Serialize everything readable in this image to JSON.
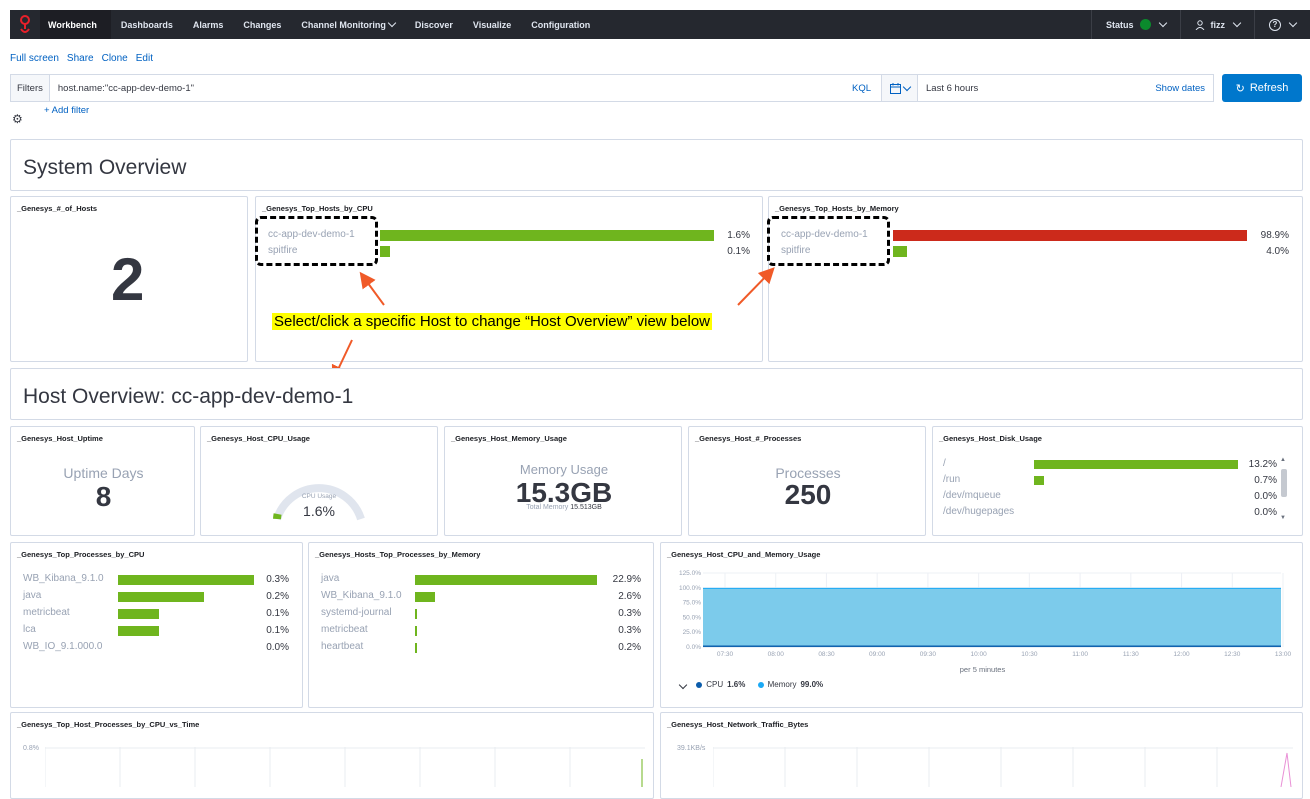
{
  "nav": {
    "brand": "Workbench",
    "items": [
      "Dashboards",
      "Alarms",
      "Changes",
      "Channel Monitoring",
      "Discover",
      "Visualize",
      "Configuration"
    ],
    "status_label": "Status",
    "user": "fizz",
    "help": "?"
  },
  "actions": {
    "full_screen": "Full screen",
    "share": "Share",
    "clone": "Clone",
    "edit": "Edit"
  },
  "filters": {
    "label": "Filters",
    "query": "host.name:\"cc-app-dev-demo-1\"",
    "kql": "KQL",
    "time_range": "Last 6 hours",
    "show_dates": "Show dates",
    "refresh": "Refresh",
    "add_filter": "+ Add filter"
  },
  "system_overview": {
    "title": "System Overview",
    "num_hosts_title": "_Genesys_#_of_Hosts",
    "num_hosts_value": "2",
    "cpu_title": "_Genesys_Top_Hosts_by_CPU",
    "cpu_hosts": [
      {
        "name": "cc-app-dev-demo-1",
        "value": "1.6%",
        "fraction": 1.0
      },
      {
        "name": "spitfire",
        "value": "0.1%",
        "fraction": 0.035
      }
    ],
    "mem_title": "_Genesys_Top_Hosts_by_Memory",
    "mem_hosts": [
      {
        "name": "cc-app-dev-demo-1",
        "value": "98.9%",
        "fraction": 1.0
      },
      {
        "name": "spitfire",
        "value": "4.0%",
        "fraction": 0.04
      }
    ]
  },
  "annotation": "Select/click a specific Host to change “Host Overview” view below",
  "host_overview": {
    "title": "Host Overview: cc-app-dev-demo-1",
    "uptime_title": "_Genesys_Host_Uptime",
    "uptime_label": "Uptime Days",
    "uptime_value": "8",
    "cpu_title": "_Genesys_Host_CPU_Usage",
    "cpu_gauge_label": "CPU Usage",
    "cpu_gauge_value": "1.6%",
    "cpu_gauge_fraction": 0.016,
    "mem_title": "_Genesys_Host_Memory_Usage",
    "mem_label": "Memory Usage",
    "mem_value": "15.3GB",
    "mem_total_label": "Total Memory",
    "mem_total_value": "15.513GB",
    "proc_title": "_Genesys_Host_#_Processes",
    "proc_label": "Processes",
    "proc_value": "250",
    "disk_title": "_Genesys_Host_Disk_Usage",
    "disk_rows": [
      {
        "name": "/",
        "value": "13.2%",
        "fraction": 1.0
      },
      {
        "name": "/run",
        "value": "0.7%",
        "fraction": 0.05
      },
      {
        "name": "/dev/mqueue",
        "value": "0.0%",
        "fraction": 0
      },
      {
        "name": "/dev/hugepages",
        "value": "0.0%",
        "fraction": 0
      }
    ]
  },
  "processes_cpu": {
    "title": "_Genesys_Top_Processes_by_CPU",
    "rows": [
      {
        "name": "WB_Kibana_9.1.0",
        "value": "0.3%",
        "fraction": 1.0
      },
      {
        "name": "java",
        "value": "0.2%",
        "fraction": 0.63
      },
      {
        "name": "metricbeat",
        "value": "0.1%",
        "fraction": 0.3
      },
      {
        "name": "lca",
        "value": "0.1%",
        "fraction": 0.3
      },
      {
        "name": "WB_IO_9.1.000.0",
        "value": "0.0%",
        "fraction": 0
      }
    ]
  },
  "processes_mem": {
    "title": "_Genesys_Hosts_Top_Processes_by_Memory",
    "rows": [
      {
        "name": "java",
        "value": "22.9%",
        "fraction": 1.0
      },
      {
        "name": "WB_Kibana_9.1.0",
        "value": "2.6%",
        "fraction": 0.11
      },
      {
        "name": "systemd-journal",
        "value": "0.3%",
        "fraction": 0.013
      },
      {
        "name": "metricbeat",
        "value": "0.3%",
        "fraction": 0.013
      },
      {
        "name": "heartbeat",
        "value": "0.2%",
        "fraction": 0.01
      }
    ]
  },
  "cpu_mem_chart": {
    "title": "_Genesys_Host_CPU_and_Memory_Usage",
    "y_ticks": [
      "125.0%",
      "100.0%",
      "75.0%",
      "50.0%",
      "25.0%",
      "0.0%"
    ],
    "x_ticks": [
      "07:30",
      "08:00",
      "08:30",
      "09:00",
      "09:30",
      "10:00",
      "10:30",
      "11:00",
      "11:30",
      "12:00",
      "12:30",
      "13:00"
    ],
    "x_label": "per 5 minutes",
    "legend": [
      {
        "label": "CPU",
        "value": "1.6%",
        "color": "#0b5cab"
      },
      {
        "label": "Memory",
        "value": "99.0%",
        "color": "#1ba9f5"
      }
    ]
  },
  "chart_data": {
    "type": "area",
    "x": [
      "07:30",
      "08:00",
      "08:30",
      "09:00",
      "09:30",
      "10:00",
      "10:30",
      "11:00",
      "11:30",
      "12:00",
      "12:30",
      "13:00"
    ],
    "series": [
      {
        "name": "CPU",
        "values": [
          1.6,
          1.6,
          1.6,
          1.6,
          1.6,
          1.6,
          1.6,
          1.6,
          1.6,
          1.6,
          1.6,
          1.6
        ]
      },
      {
        "name": "Memory",
        "values": [
          99,
          99,
          99,
          99,
          99,
          99,
          99,
          99,
          99,
          99,
          99,
          99
        ]
      }
    ],
    "xlabel": "per 5 minutes",
    "ylim": [
      0,
      125
    ],
    "grid": true
  },
  "bottom_left": {
    "title": "_Genesys_Top_Host_Processes_by_CPU_vs_Time",
    "y_tick": "0.8%"
  },
  "bottom_right": {
    "title": "_Genesys_Host_Network_Traffic_Bytes",
    "y_tick": "39.1KB/s"
  }
}
